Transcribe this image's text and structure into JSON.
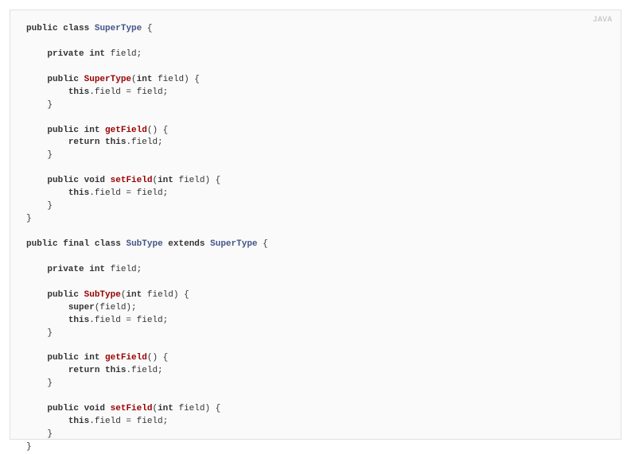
{
  "language_badge": "JAVA",
  "code": {
    "tokens": [
      {
        "t": "kw",
        "v": "public"
      },
      {
        "t": "plain",
        "v": " "
      },
      {
        "t": "kw",
        "v": "class"
      },
      {
        "t": "plain",
        "v": " "
      },
      {
        "t": "type",
        "v": "SuperType"
      },
      {
        "t": "plain",
        "v": " {\n\n    "
      },
      {
        "t": "kw",
        "v": "private"
      },
      {
        "t": "plain",
        "v": " "
      },
      {
        "t": "kw",
        "v": "int"
      },
      {
        "t": "plain",
        "v": " field;\n\n    "
      },
      {
        "t": "kw",
        "v": "public"
      },
      {
        "t": "plain",
        "v": " "
      },
      {
        "t": "method",
        "v": "SuperType"
      },
      {
        "t": "plain",
        "v": "("
      },
      {
        "t": "kw",
        "v": "int"
      },
      {
        "t": "plain",
        "v": " field) {\n        "
      },
      {
        "t": "kw",
        "v": "this"
      },
      {
        "t": "plain",
        "v": ".field = field;\n    }\n\n    "
      },
      {
        "t": "kw",
        "v": "public"
      },
      {
        "t": "plain",
        "v": " "
      },
      {
        "t": "kw",
        "v": "int"
      },
      {
        "t": "plain",
        "v": " "
      },
      {
        "t": "method",
        "v": "getField"
      },
      {
        "t": "plain",
        "v": "() {\n        "
      },
      {
        "t": "kw",
        "v": "return"
      },
      {
        "t": "plain",
        "v": " "
      },
      {
        "t": "kw",
        "v": "this"
      },
      {
        "t": "plain",
        "v": ".field;\n    }\n\n    "
      },
      {
        "t": "kw",
        "v": "public"
      },
      {
        "t": "plain",
        "v": " "
      },
      {
        "t": "kw",
        "v": "void"
      },
      {
        "t": "plain",
        "v": " "
      },
      {
        "t": "method",
        "v": "setField"
      },
      {
        "t": "plain",
        "v": "("
      },
      {
        "t": "kw",
        "v": "int"
      },
      {
        "t": "plain",
        "v": " field) {\n        "
      },
      {
        "t": "kw",
        "v": "this"
      },
      {
        "t": "plain",
        "v": ".field = field;\n    }\n}\n\n"
      },
      {
        "t": "kw",
        "v": "public"
      },
      {
        "t": "plain",
        "v": " "
      },
      {
        "t": "kw",
        "v": "final"
      },
      {
        "t": "plain",
        "v": " "
      },
      {
        "t": "kw",
        "v": "class"
      },
      {
        "t": "plain",
        "v": " "
      },
      {
        "t": "type",
        "v": "SubType"
      },
      {
        "t": "plain",
        "v": " "
      },
      {
        "t": "kw",
        "v": "extends"
      },
      {
        "t": "plain",
        "v": " "
      },
      {
        "t": "type",
        "v": "SuperType"
      },
      {
        "t": "plain",
        "v": " {\n\n    "
      },
      {
        "t": "kw",
        "v": "private"
      },
      {
        "t": "plain",
        "v": " "
      },
      {
        "t": "kw",
        "v": "int"
      },
      {
        "t": "plain",
        "v": " field;\n\n    "
      },
      {
        "t": "kw",
        "v": "public"
      },
      {
        "t": "plain",
        "v": " "
      },
      {
        "t": "method",
        "v": "SubType"
      },
      {
        "t": "plain",
        "v": "("
      },
      {
        "t": "kw",
        "v": "int"
      },
      {
        "t": "plain",
        "v": " field) {\n        "
      },
      {
        "t": "kw",
        "v": "super"
      },
      {
        "t": "plain",
        "v": "(field);\n        "
      },
      {
        "t": "kw",
        "v": "this"
      },
      {
        "t": "plain",
        "v": ".field = field;\n    }\n\n    "
      },
      {
        "t": "kw",
        "v": "public"
      },
      {
        "t": "plain",
        "v": " "
      },
      {
        "t": "kw",
        "v": "int"
      },
      {
        "t": "plain",
        "v": " "
      },
      {
        "t": "method",
        "v": "getField"
      },
      {
        "t": "plain",
        "v": "() {\n        "
      },
      {
        "t": "kw",
        "v": "return"
      },
      {
        "t": "plain",
        "v": " "
      },
      {
        "t": "kw",
        "v": "this"
      },
      {
        "t": "plain",
        "v": ".field;\n    }\n\n    "
      },
      {
        "t": "kw",
        "v": "public"
      },
      {
        "t": "plain",
        "v": " "
      },
      {
        "t": "kw",
        "v": "void"
      },
      {
        "t": "plain",
        "v": " "
      },
      {
        "t": "method",
        "v": "setField"
      },
      {
        "t": "plain",
        "v": "("
      },
      {
        "t": "kw",
        "v": "int"
      },
      {
        "t": "plain",
        "v": " field) {\n        "
      },
      {
        "t": "kw",
        "v": "this"
      },
      {
        "t": "plain",
        "v": ".field = field;\n    }\n}"
      }
    ]
  }
}
